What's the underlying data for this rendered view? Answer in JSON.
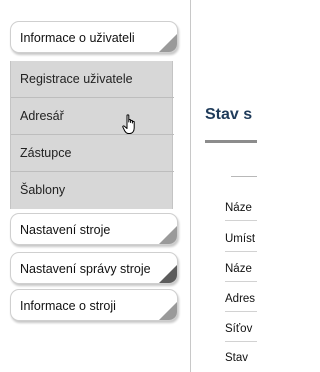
{
  "nav": {
    "tab_user_info": "Informace o uživateli",
    "submenu": [
      {
        "label": "Registrace uživatele"
      },
      {
        "label": "Adresář"
      },
      {
        "label": "Zástupce"
      },
      {
        "label": "Šablony"
      }
    ],
    "tab_machine_settings": "Nastavení stroje",
    "tab_machine_admin_settings": "Nastavení správy stroje",
    "tab_machine_info": "Informace o stroji"
  },
  "content": {
    "title": "Stav s",
    "rows": [
      "Náze",
      "Umíst",
      "Náze",
      "Adres",
      "Síťov",
      "Stav"
    ]
  }
}
